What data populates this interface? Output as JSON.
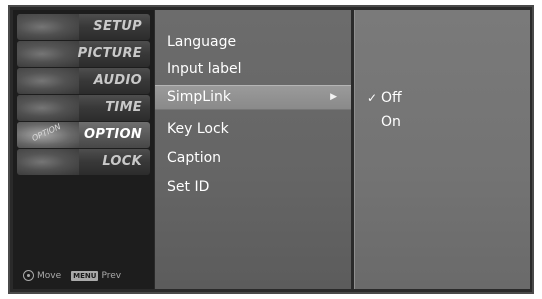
{
  "sidebar": {
    "items": [
      {
        "label": "SETUP"
      },
      {
        "label": "PICTURE"
      },
      {
        "label": "AUDIO"
      },
      {
        "label": "TIME"
      },
      {
        "label": "OPTION",
        "art_text": "OPTION"
      },
      {
        "label": "LOCK"
      }
    ],
    "footer": {
      "move_label": "Move",
      "menu_key": "MENU",
      "prev_label": "Prev"
    }
  },
  "options": {
    "items": [
      {
        "label": "Language"
      },
      {
        "label": "Input label"
      },
      {
        "label": "SimpLink",
        "arrow": "▶"
      },
      {
        "label": "Key Lock"
      },
      {
        "label": "Caption"
      },
      {
        "label": "Set ID"
      }
    ]
  },
  "values": {
    "items": [
      {
        "label": "Off",
        "check": "✓"
      },
      {
        "label": "On"
      }
    ]
  }
}
